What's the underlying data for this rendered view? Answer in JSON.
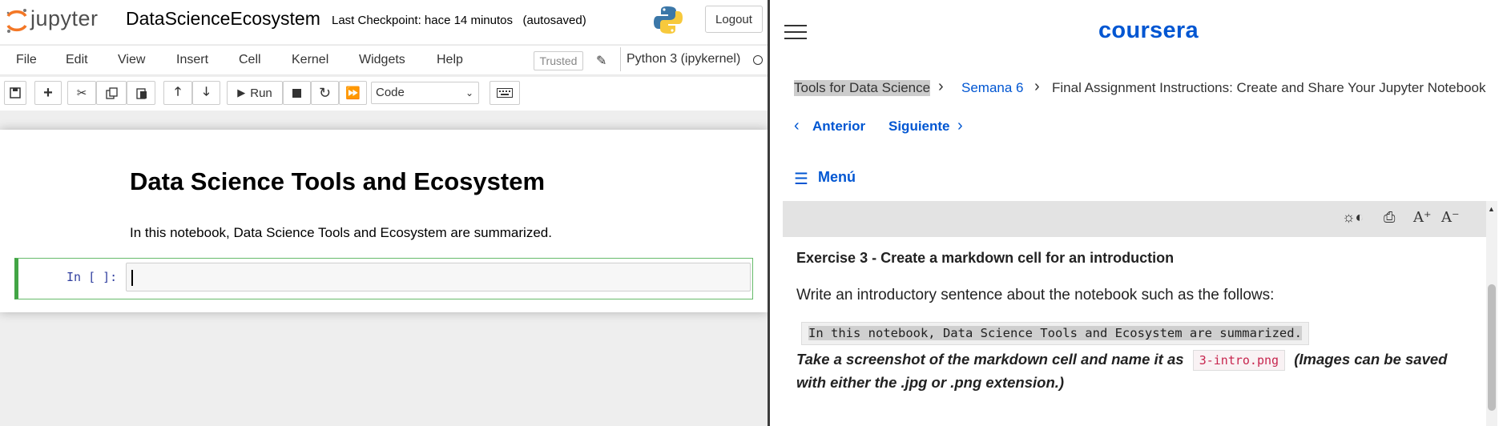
{
  "jupyter": {
    "logo_text": "jupyter",
    "notebook_name": "DataScienceEcosystem",
    "checkpoint": "Last Checkpoint: hace 14 minutos",
    "autosaved": "(autosaved)",
    "logout": "Logout",
    "menu": [
      "File",
      "Edit",
      "View",
      "Insert",
      "Cell",
      "Kernel",
      "Widgets",
      "Help"
    ],
    "trusted": "Trusted",
    "kernel_name": "Python 3 (ipykernel)",
    "toolbar": {
      "run_label": "Run",
      "cell_type": "Code"
    },
    "notebook": {
      "heading": "Data Science Tools and Ecosystem",
      "paragraph": "In this notebook, Data Science Tools and Ecosystem are summarized.",
      "prompt": "In [ ]:"
    }
  },
  "coursera": {
    "logo": "coursera",
    "breadcrumb": {
      "course": "Tools for Data Science",
      "week": "Semana 6",
      "page": "Final Assignment Instructions: Create and Share Your Jupyter Notebook"
    },
    "nav": {
      "prev": "Anterior",
      "next": "Siguiente"
    },
    "menu_label": "Menú",
    "doc_tools": {
      "font_up": "A⁺",
      "font_down": "A⁻"
    },
    "exercise": {
      "title": "Exercise 3 - Create a markdown cell for an introduction",
      "text": "Write an introductory sentence about the notebook such as the follows:",
      "code_sample": "In this notebook, Data Science Tools and Ecosystem are summarized.",
      "instr_part1": "Take a screenshot of the markdown cell and name it as",
      "filename": "3-intro.png",
      "instr_part2": "(Images can be saved with either the .jpg or .png extension.)"
    }
  },
  "colors": {
    "coursera_blue": "#0056d2",
    "jupyter_orange": "#f37726",
    "cell_green": "#42a545",
    "prompt_blue": "#303f9f"
  }
}
